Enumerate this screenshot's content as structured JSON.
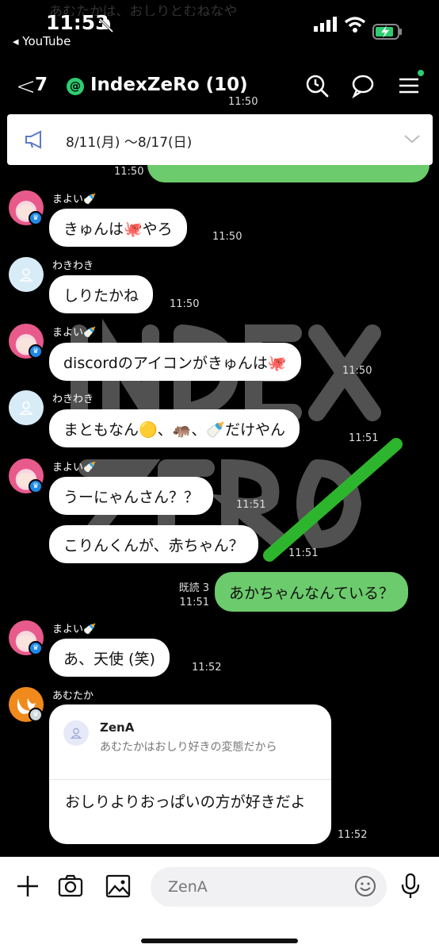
{
  "status": {
    "time": "11:53",
    "back_app": "◂ YouTube",
    "ghost_text": "あむたかは、おしりとむねなや"
  },
  "header": {
    "unread_count": "7",
    "title": "IndexZeRo (10)"
  },
  "announcement": {
    "text": "8/11(月) 〜8/17(日)"
  },
  "top_times": {
    "t1": "11:50",
    "t2": "11:50"
  },
  "messages": [
    {
      "sender": "まよい🍼",
      "text": "きゅんは🐙やろ",
      "time": "11:50"
    },
    {
      "sender": "わきわき",
      "text": "しりたかね",
      "time": "11:50"
    },
    {
      "sender": "まよい🍼",
      "text": "discordのアイコンがきゅんは🐙",
      "time": "11:50"
    },
    {
      "sender": "わきわき",
      "text": "まともなん🟡、🦛、🍼だけやん",
      "time": "11:51"
    },
    {
      "sender": "まよい🍼",
      "text": "うーにゃんさん？？",
      "time": "11:51"
    },
    {
      "text": "こりんくんが、赤ちゃん？",
      "time": "11:51"
    },
    {
      "read": "既読 3",
      "text": "あかちゃんなんている？",
      "time": "11:51"
    },
    {
      "sender": "まよい🍼",
      "text": "あ、天使 (笑)",
      "time": "11:52"
    }
  ],
  "reply": {
    "sender": "あむたか",
    "quote_name": "ZenA",
    "quote_text": "あむたかはおしり好きの変態だから",
    "text": "おしりよりおっぱいの方が好きだよ",
    "time": "11:52"
  },
  "input": {
    "placeholder": "ZenA"
  },
  "colors": {
    "green_bubble": "#6ccb6c",
    "accent": "#2ecc71",
    "crown": "#1e88e5"
  }
}
